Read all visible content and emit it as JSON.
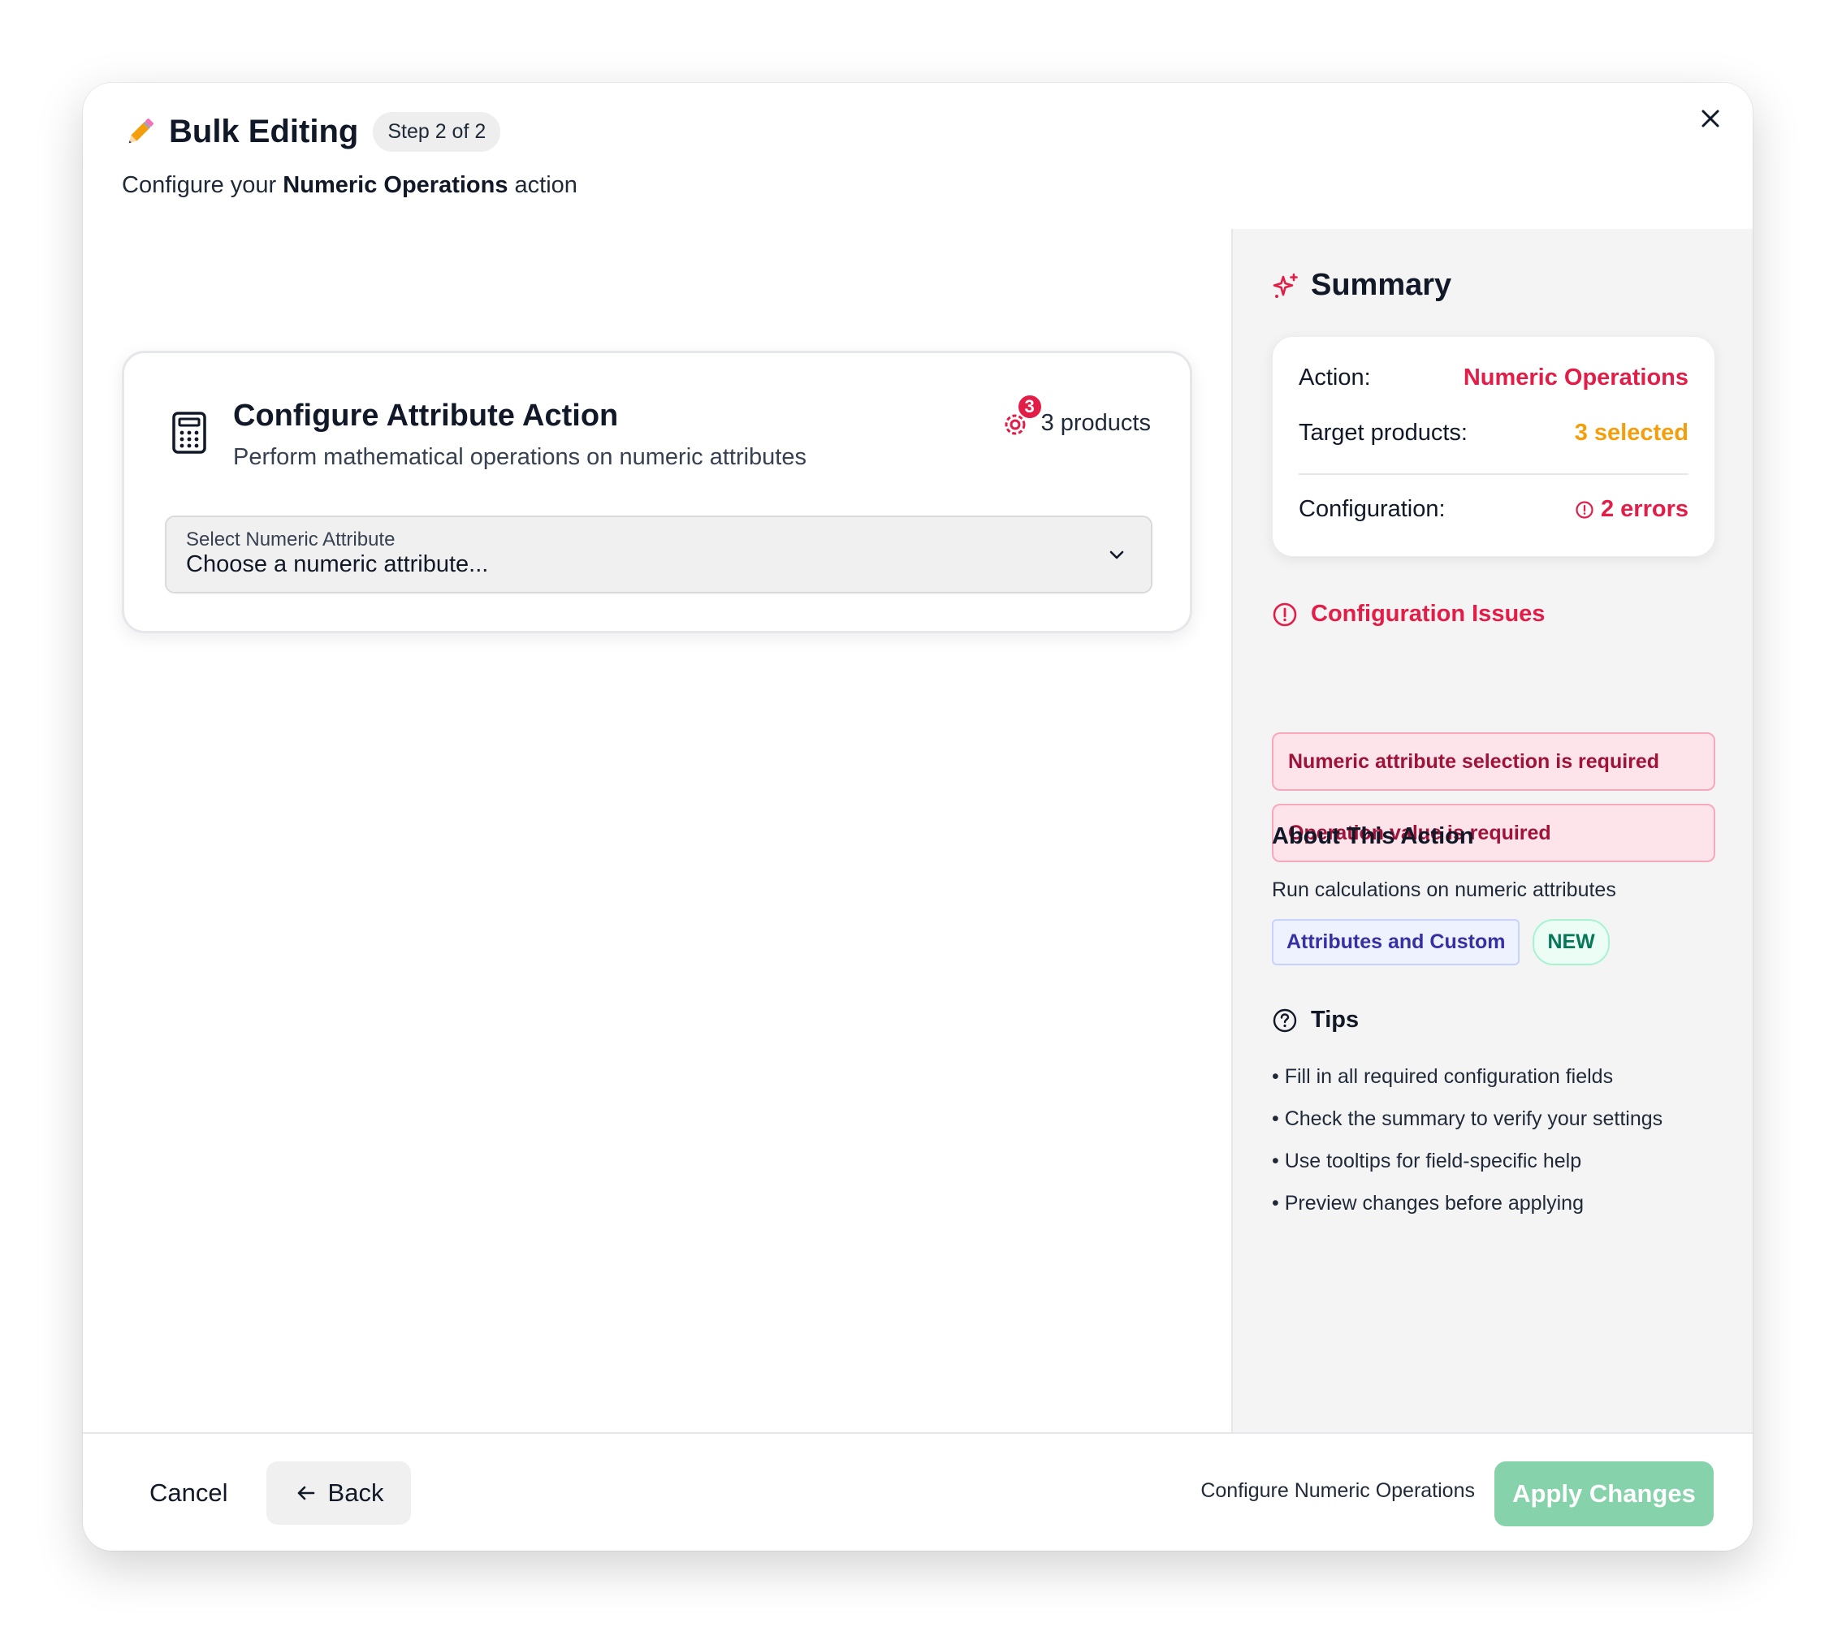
{
  "header": {
    "title": "Bulk Editing",
    "step": "Step 2 of 2",
    "subtitle_prefix": "Configure your ",
    "subtitle_action": "Numeric Operations",
    "subtitle_suffix": " action",
    "icon": "pencil-icon"
  },
  "card": {
    "title": "Configure Attribute Action",
    "description": "Perform mathematical operations on numeric attributes",
    "icon": "calculator-icon",
    "product_badge": "3",
    "product_text": "3 products",
    "select": {
      "label": "Select Numeric Attribute",
      "value": "Choose a numeric attribute..."
    }
  },
  "summary": {
    "title": "Summary",
    "rows": [
      {
        "label": "Action:",
        "value": "Numeric Operations"
      },
      {
        "label": "Target products:",
        "value": "3 selected"
      },
      {
        "label": "Configuration:",
        "value": "2 errors"
      }
    ]
  },
  "issues": {
    "title": "Configuration Issues",
    "items": [
      "Numeric attribute selection is required",
      "Operation value is required"
    ]
  },
  "about": {
    "title": "About This Action",
    "description": "Run calculations on numeric attributes",
    "tags": [
      "Attributes and Custom",
      "NEW"
    ]
  },
  "tips": {
    "title": "Tips",
    "items": [
      "• Fill in all required configuration fields",
      "• Check the summary to verify your settings",
      "• Use tooltips for field-specific help",
      "• Preview changes before applying"
    ]
  },
  "footer": {
    "cancel": "Cancel",
    "back": "Back",
    "hint": "Configure Numeric Operations",
    "apply": "Apply Changes"
  },
  "colors": {
    "accent_red": "#e11d48",
    "accent_amber": "#f59e0b",
    "apply_disabled": "#86d2aa"
  }
}
